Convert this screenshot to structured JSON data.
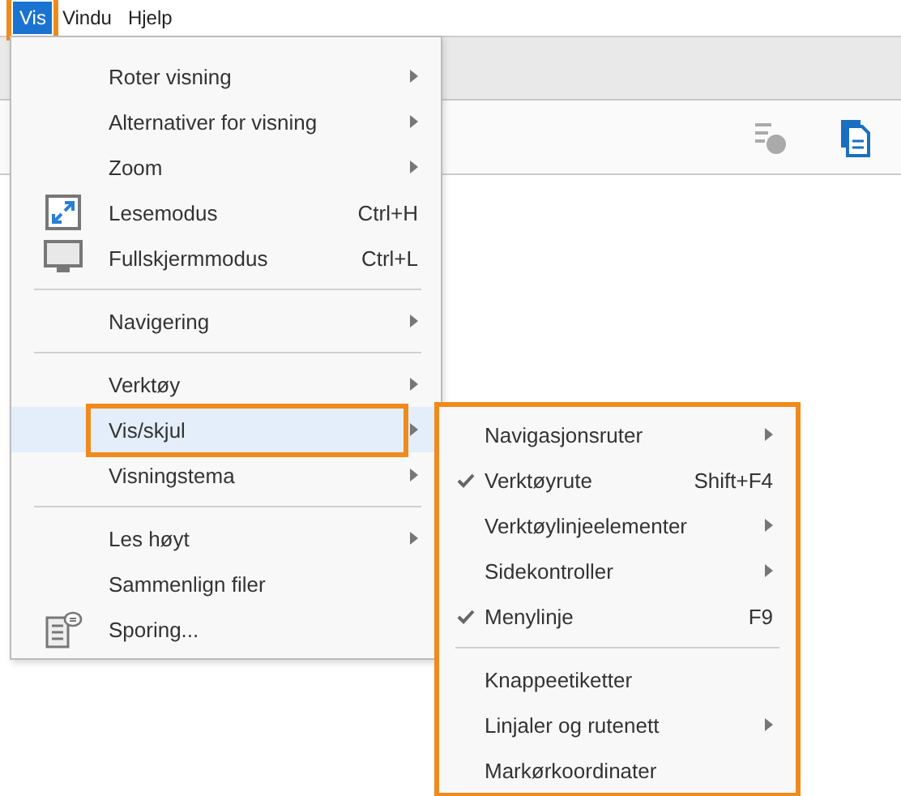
{
  "menu_bar": [
    {
      "label": "Vis",
      "selected": true,
      "annotated": true
    },
    {
      "label": "Vindu",
      "selected": false,
      "annotated": false
    },
    {
      "label": "Hjelp",
      "selected": false,
      "annotated": false
    }
  ],
  "view_menu": [
    {
      "kind": "item",
      "label": "Roter visning",
      "submenu": true,
      "selected": false,
      "annotated": false
    },
    {
      "kind": "item",
      "label": "Alternativer for visning",
      "submenu": true,
      "selected": false,
      "annotated": false
    },
    {
      "kind": "item",
      "label": "Zoom",
      "submenu": true,
      "selected": false,
      "annotated": false
    },
    {
      "kind": "iconitem",
      "label": "Lesemodus",
      "shortcut": "Ctrl+H",
      "submenu": false,
      "selected": false,
      "annotated": false
    },
    {
      "kind": "iconitem",
      "label": "Fullskjermmodus",
      "shortcut": "Ctrl+L",
      "submenu": false,
      "selected": false,
      "annotated": false
    },
    {
      "kind": "separator"
    },
    {
      "kind": "item",
      "label": "Navigering",
      "submenu": true,
      "selected": false,
      "annotated": false
    },
    {
      "kind": "separator"
    },
    {
      "kind": "item",
      "label": "Verktøy",
      "submenu": true,
      "selected": false,
      "annotated": false
    },
    {
      "kind": "item",
      "label": "Vis/skjul",
      "submenu": true,
      "selected": true,
      "annotated": true
    },
    {
      "kind": "item",
      "label": "Visningstema",
      "submenu": true,
      "selected": false,
      "annotated": false
    },
    {
      "kind": "separator"
    },
    {
      "kind": "item",
      "label": "Les høyt",
      "submenu": true,
      "selected": false,
      "annotated": false
    },
    {
      "kind": "item",
      "label": "Sammenlign filer",
      "submenu": false,
      "selected": false,
      "annotated": false
    },
    {
      "kind": "iconitem",
      "label": "Sporing...",
      "submenu": false,
      "selected": false,
      "annotated": false
    }
  ],
  "show_hide_submenu": {
    "annotated": true,
    "items": [
      {
        "kind": "item",
        "label": "Navigasjonsruter",
        "checked": false,
        "submenu": true
      },
      {
        "kind": "item",
        "label": "Verktøyrute",
        "checked": true,
        "shortcut": "Shift+F4",
        "submenu": false
      },
      {
        "kind": "item",
        "label": "Verktøylinjeelementer",
        "checked": false,
        "submenu": true
      },
      {
        "kind": "item",
        "label": "Sidekontroller",
        "checked": false,
        "submenu": true
      },
      {
        "kind": "item",
        "label": "Menylinje",
        "checked": true,
        "shortcut": "F9",
        "submenu": false
      },
      {
        "kind": "separator"
      },
      {
        "kind": "item",
        "label": "Knappeetiketter",
        "checked": false,
        "submenu": false
      },
      {
        "kind": "item",
        "label": "Linjaler og rutenett",
        "checked": false,
        "submenu": true
      },
      {
        "kind": "item",
        "label": "Markørkoordinater",
        "checked": false,
        "submenu": false
      }
    ]
  }
}
